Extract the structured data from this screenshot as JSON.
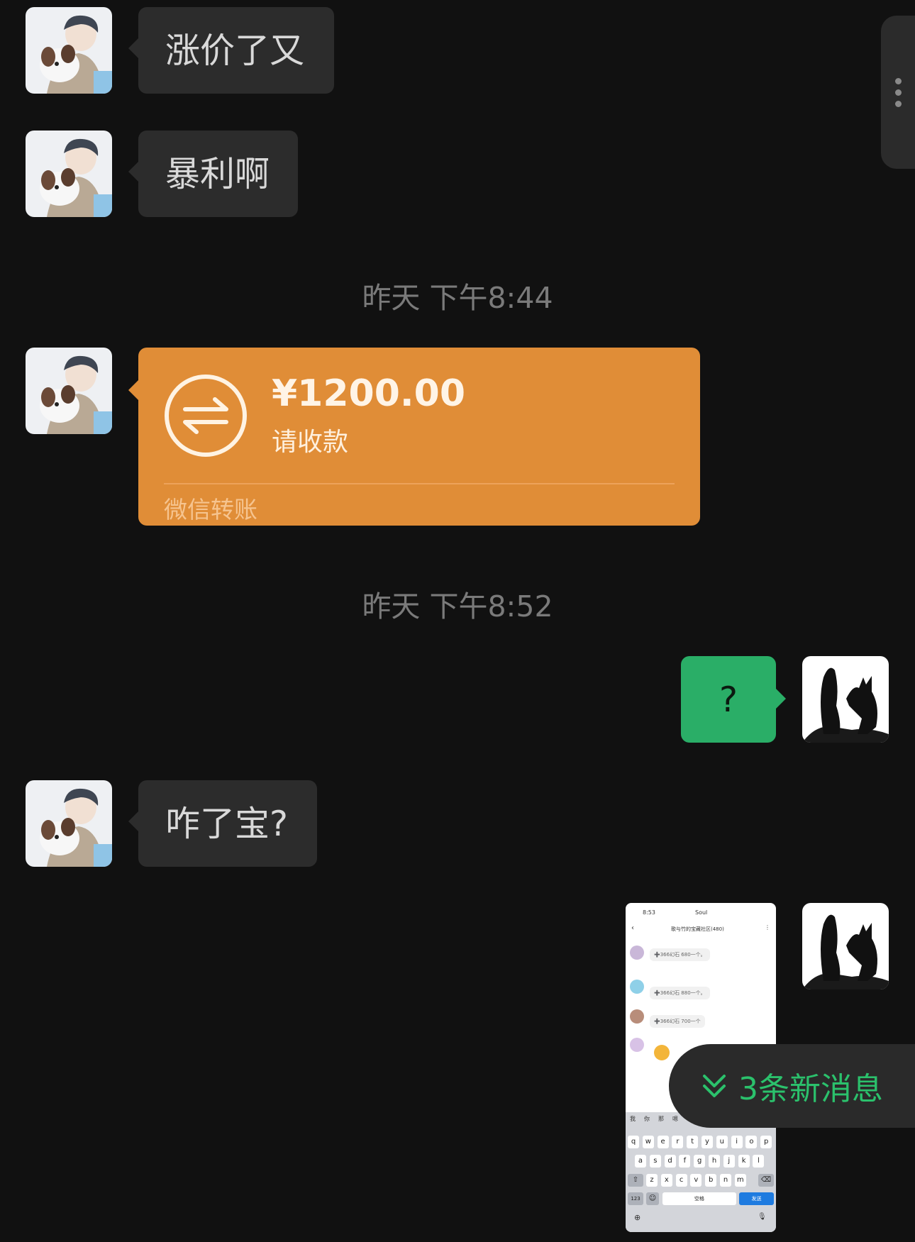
{
  "messages": [
    {
      "text": "涨价了又"
    },
    {
      "text": "暴利啊"
    },
    {
      "text": "?"
    },
    {
      "text": "咋了宝?"
    }
  ],
  "timestamps": [
    "昨天 下午8:44",
    "昨天 下午8:52"
  ],
  "transfer": {
    "amount": "¥1200.00",
    "status": "请收款",
    "brand": "微信转账"
  },
  "new_messages": {
    "label": "3条新消息"
  },
  "colors": {
    "background": "#111111",
    "bubble_received": "#2c2c2c",
    "bubble_sent": "#2aae67",
    "transfer_card": "#e08d37",
    "new_message_accent": "#2bc16c"
  },
  "screenshot_thumbnail": {
    "time": "8:53",
    "app": "Soul",
    "title": "歌与竹的宝藏社区(480)",
    "messages": [
      "➕366幻石 680一个。",
      "➕366幻石 880一个。",
      "➕366幻石 700一个"
    ],
    "keyboard_rows": [
      [
        "q",
        "w",
        "e",
        "r",
        "t",
        "y",
        "u",
        "i",
        "o",
        "p"
      ],
      [
        "a",
        "s",
        "d",
        "f",
        "g",
        "h",
        "j",
        "k",
        "l"
      ],
      [
        "z",
        "x",
        "c",
        "v",
        "b",
        "n",
        "m"
      ]
    ],
    "keyboard_suggestions": [
      "我",
      "你",
      "那",
      "嗯"
    ],
    "key_123": "123",
    "space_label": "空格",
    "send_label": "发送"
  }
}
